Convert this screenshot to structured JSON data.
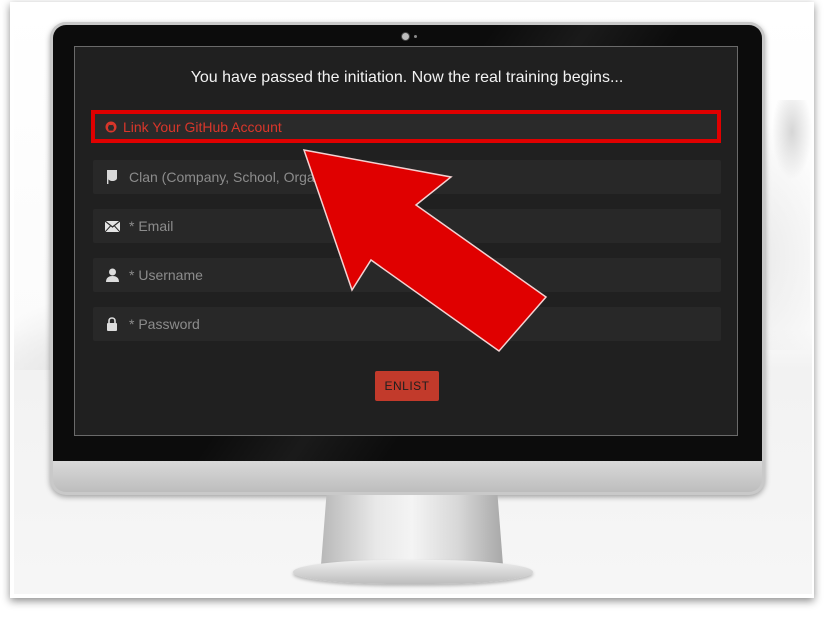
{
  "page": {
    "headline": "You have passed the initiation. Now the real training begins..."
  },
  "github": {
    "label": "Link Your GitHub Account",
    "icon": "github-icon"
  },
  "fields": {
    "clan": {
      "placeholder": "Clan (Company, School, Organization)",
      "icon": "flag-icon"
    },
    "email": {
      "placeholder": "* Email",
      "icon": "envelope-icon"
    },
    "username": {
      "placeholder": "* Username",
      "icon": "user-icon"
    },
    "password": {
      "placeholder": "* Password",
      "icon": "lock-icon"
    }
  },
  "submit": {
    "label": "ENLIST"
  },
  "colors": {
    "accent_red": "#e00000",
    "button_red": "#c23a2b",
    "screen_bg": "#202020",
    "field_bg": "#282828"
  }
}
